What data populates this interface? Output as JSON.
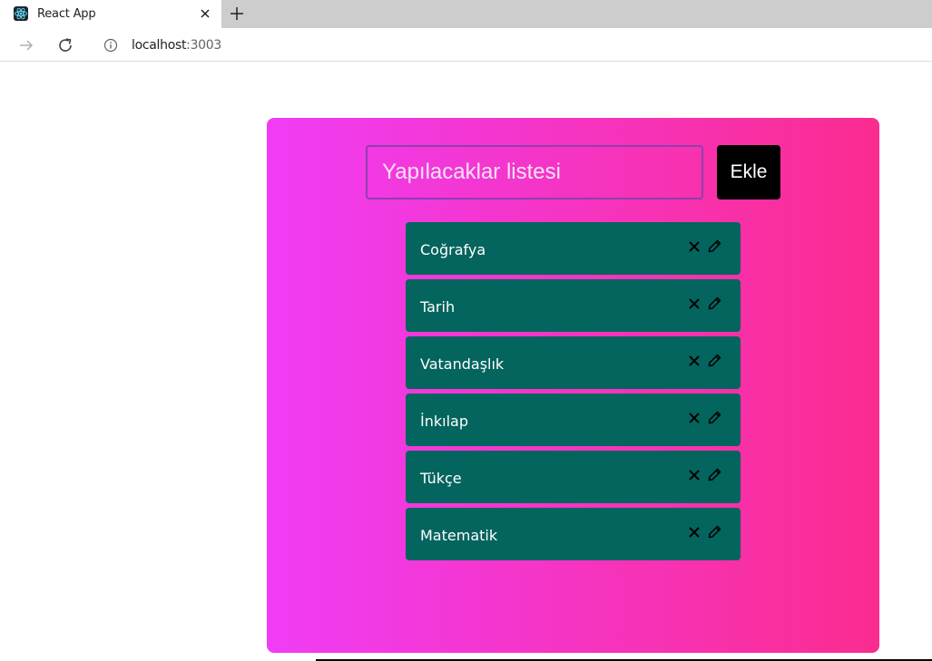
{
  "browser": {
    "tab_title": "React App",
    "url_host": "localhost",
    "url_port": ":3003"
  },
  "app": {
    "input": {
      "placeholder": "Yapılacaklar listesi",
      "value": ""
    },
    "add_button_label": "Ekle",
    "todos": [
      {
        "text": "Coğrafya"
      },
      {
        "text": "Tarih"
      },
      {
        "text": "Vatandaşlık"
      },
      {
        "text": "İnkılap"
      },
      {
        "text": "Tükçe"
      },
      {
        "text": "Matematik"
      }
    ]
  },
  "colors": {
    "gradient_start": "#f03cf5",
    "gradient_end": "#fb2c8f",
    "todo_bg": "#04645e",
    "button_bg": "#000000"
  },
  "icons": {
    "delete": "close-icon",
    "edit": "pencil-icon"
  }
}
